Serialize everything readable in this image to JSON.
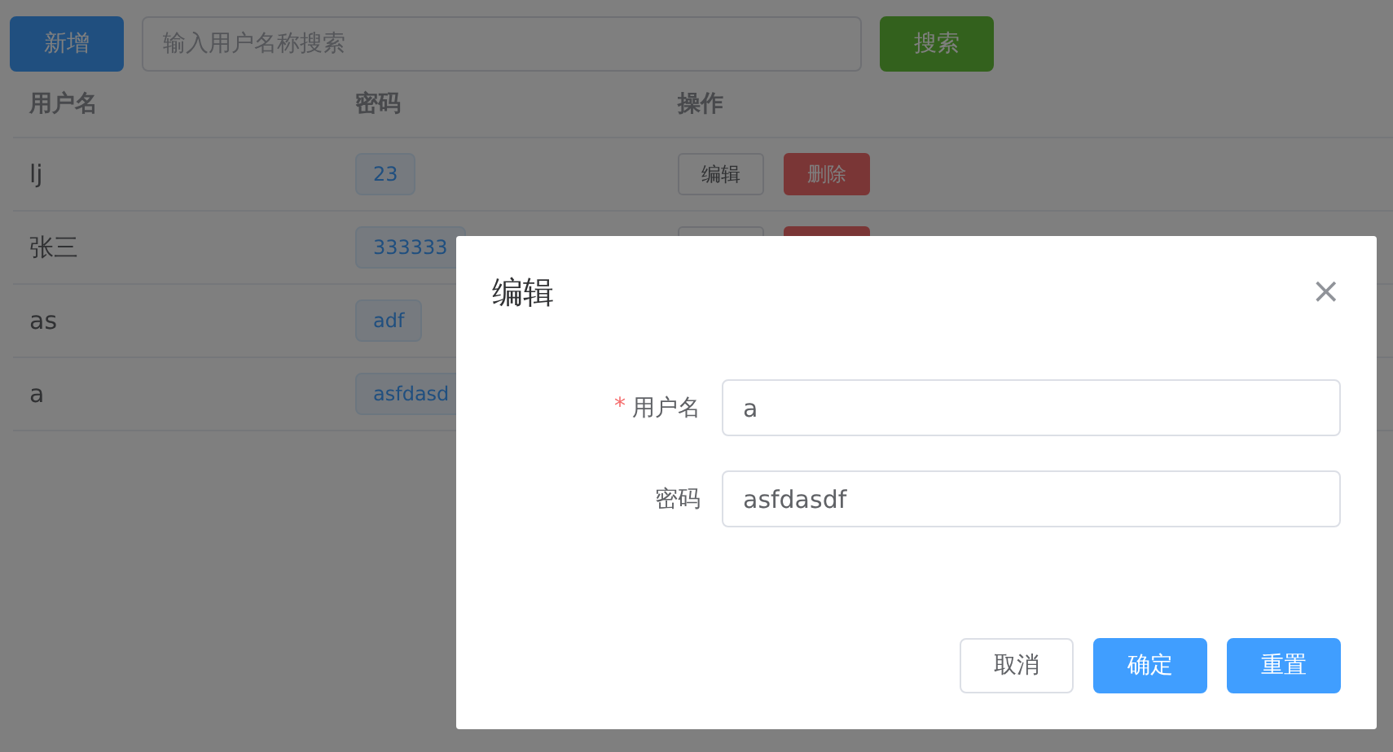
{
  "toolbar": {
    "add_button": "新增",
    "search": {
      "placeholder": "输入用户名称搜索"
    },
    "search_button": "搜索"
  },
  "table": {
    "columns": [
      "用户名",
      "密码",
      "操作"
    ],
    "rows": [
      {
        "username": "lj",
        "password": "23",
        "actions": [
          {
            "kind": "default",
            "label": "编辑"
          },
          {
            "kind": "danger",
            "label": "删除"
          }
        ]
      },
      {
        "username": "张三",
        "password": "333333",
        "actions": [
          {
            "kind": "default"
          },
          {
            "kind": "danger"
          }
        ]
      },
      {
        "username": "as",
        "password": "adf",
        "actions": []
      },
      {
        "username": "a",
        "password": "asfdasd",
        "actions": []
      }
    ]
  },
  "dialog": {
    "title": "编辑",
    "close": "×",
    "required_mark": "*",
    "fields": [
      {
        "label": "用户名",
        "required": true,
        "value": "a"
      },
      {
        "label": "密码",
        "required": false,
        "value": "asfdasdf"
      }
    ],
    "buttons": [
      {
        "kind": "default",
        "label": "取消"
      },
      {
        "kind": "primary",
        "label": "确定"
      },
      {
        "kind": "primary",
        "label": "重置"
      }
    ]
  }
}
